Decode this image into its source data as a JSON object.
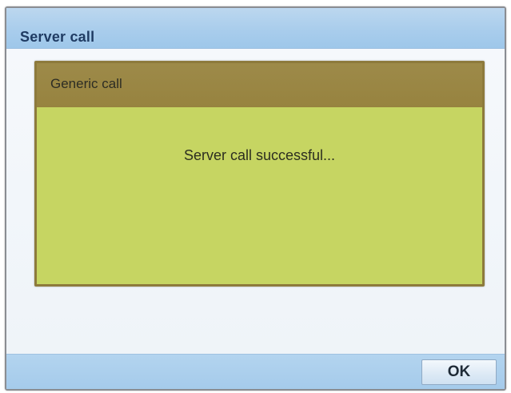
{
  "window": {
    "title": "Server call"
  },
  "panel": {
    "title": "Generic call",
    "message": "Server call successful..."
  },
  "footer": {
    "ok_label": "OK"
  },
  "colors": {
    "titlebar": "#a9cdec",
    "panel_header": "#97833f",
    "panel_body": "#c6d562",
    "footer": "#a5cbeb"
  }
}
